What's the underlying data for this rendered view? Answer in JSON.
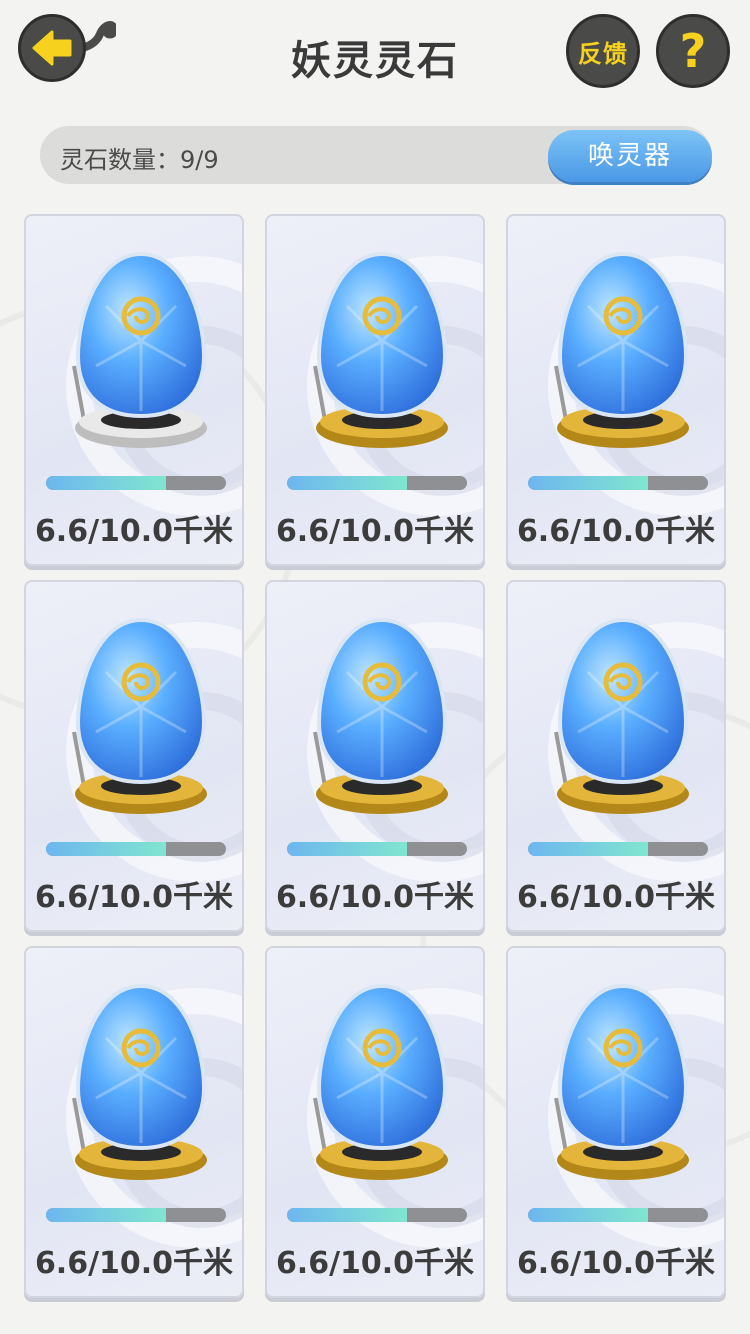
{
  "header": {
    "title": "妖灵灵石",
    "feedback_label": "反馈",
    "help_label": "?"
  },
  "count_bar": {
    "label": "灵石数量：9/9",
    "summon_label": "唤灵器"
  },
  "colors": {
    "button_yellow": "#f6d21e",
    "button_dark": "#4a4a48",
    "summon_blue": "#4a98e6",
    "progress_fill_start": "#6db6ef",
    "progress_fill_end": "#80e6cf",
    "progress_track": "#8e9094"
  },
  "stones": [
    {
      "distance": "6.6/10.0千米",
      "progress": 0.667,
      "base": "silver"
    },
    {
      "distance": "6.6/10.0千米",
      "progress": 0.667,
      "base": "gold"
    },
    {
      "distance": "6.6/10.0千米",
      "progress": 0.667,
      "base": "gold"
    },
    {
      "distance": "6.6/10.0千米",
      "progress": 0.667,
      "base": "gold"
    },
    {
      "distance": "6.6/10.0千米",
      "progress": 0.667,
      "base": "gold"
    },
    {
      "distance": "6.6/10.0千米",
      "progress": 0.667,
      "base": "gold"
    },
    {
      "distance": "6.6/10.0千米",
      "progress": 0.667,
      "base": "gold"
    },
    {
      "distance": "6.6/10.0千米",
      "progress": 0.667,
      "base": "gold"
    },
    {
      "distance": "6.6/10.0千米",
      "progress": 0.667,
      "base": "gold"
    }
  ]
}
